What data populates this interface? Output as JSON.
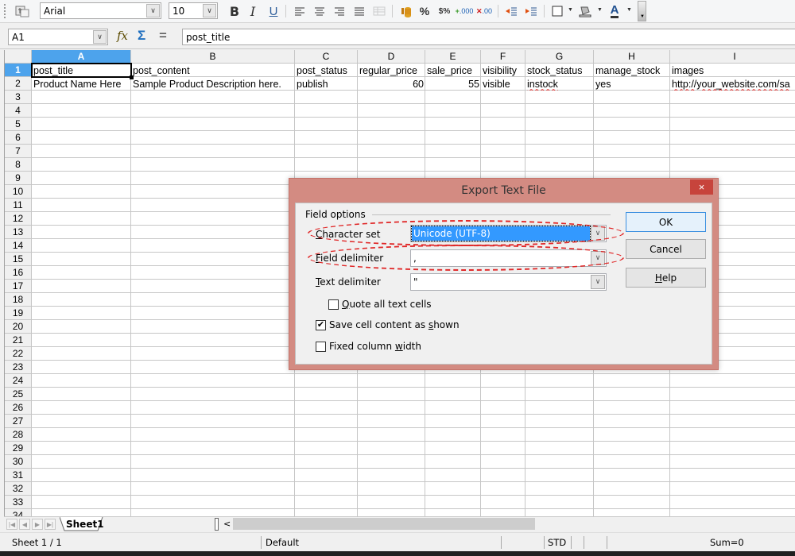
{
  "toolbar": {
    "font_name": "Arial",
    "font_size": "10",
    "icons": [
      "styles-icon",
      "bold-icon",
      "italic-icon",
      "underline-icon",
      "align-left-icon",
      "align-center-icon",
      "align-right-icon",
      "justify-icon",
      "merge-cells-icon",
      "currency-icon",
      "percent-icon",
      "number-format-icon",
      "add-decimal-icon",
      "delete-decimal-icon",
      "decrease-indent-icon",
      "increase-indent-icon",
      "borders-icon",
      "background-color-icon",
      "font-color-icon"
    ],
    "bold": "B",
    "italic": "I",
    "underline": "U",
    "percent": "%"
  },
  "formula_bar": {
    "name_box": "A1",
    "function_wizard": "fx",
    "sum": "Σ",
    "equals": "=",
    "content": "post_title"
  },
  "sheet": {
    "columns": [
      "A",
      "B",
      "C",
      "D",
      "E",
      "F",
      "G",
      "H",
      "I"
    ],
    "selected_column": "A",
    "selected_row": 1,
    "rows": [
      "1",
      "2",
      "3",
      "4",
      "5",
      "6",
      "7",
      "8",
      "9",
      "10",
      "11",
      "12",
      "13",
      "14",
      "15",
      "16",
      "17",
      "18",
      "19",
      "20",
      "21",
      "22",
      "23",
      "24",
      "25",
      "26",
      "27",
      "28",
      "29",
      "30",
      "31",
      "32",
      "33",
      "34"
    ],
    "header_row": [
      "post_title",
      "post_content",
      "post_status",
      "regular_price",
      "sale_price",
      "visibility",
      "stock_status",
      "manage_stock",
      "images"
    ],
    "data_row": [
      "Product Name Here",
      "Sample Product Description here.",
      "publish",
      "60",
      "55",
      "visible",
      "instock",
      "yes",
      "http://your_website.com/sa"
    ]
  },
  "tabs": {
    "sheets": [
      "Sheet1"
    ],
    "scroll_left": "<"
  },
  "status": {
    "sheet_info": "Sheet 1 / 1",
    "page_style": "Default",
    "mode": "STD",
    "sum": "Sum=0"
  },
  "dialog": {
    "title": "Export Text File",
    "close": "×",
    "group_label": "Field options",
    "character_set_label_u": "C",
    "character_set_label_rest": "haracter set",
    "character_set_value": "Unicode (UTF-8)",
    "field_delimiter_label_u": "F",
    "field_delimiter_label_rest": "ield delimiter",
    "field_delimiter_value": ",",
    "text_delimiter_label_u": "T",
    "text_delimiter_label_rest": "ext delimiter",
    "text_delimiter_value": "\"",
    "quote_all_u": "Q",
    "quote_all_rest": "uote all text cells",
    "quote_all_checked": false,
    "save_as_shown_pre": "Save cell content as ",
    "save_as_shown_u": "s",
    "save_as_shown_rest": "hown",
    "save_as_shown_checked": true,
    "fixed_width_pre": "Fixed column ",
    "fixed_width_u": "w",
    "fixed_width_rest": "idth",
    "fixed_width_checked": false,
    "check_mark": "✔",
    "ok": "OK",
    "cancel": "Cancel",
    "help_u": "H",
    "help_rest": "elp",
    "annotation_color": "#e02828"
  }
}
